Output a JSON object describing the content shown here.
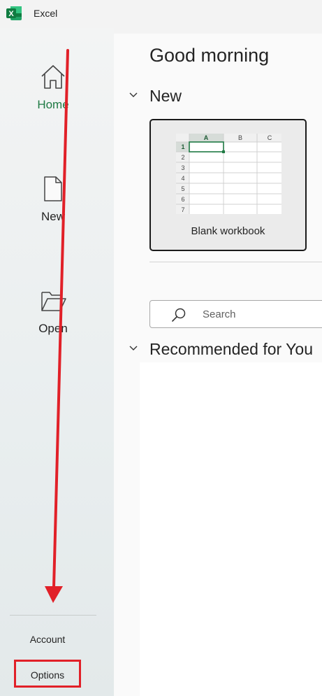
{
  "app": {
    "title": "Excel",
    "logo_letter": "X"
  },
  "sidebar": {
    "items": [
      {
        "label": "Home",
        "icon": "home-icon",
        "active": true
      },
      {
        "label": "New",
        "icon": "new-document-icon",
        "active": false
      },
      {
        "label": "Open",
        "icon": "folder-open-icon",
        "active": false
      }
    ],
    "account_label": "Account",
    "options_label": "Options"
  },
  "main": {
    "greeting": "Good morning",
    "new_section": {
      "title": "New",
      "templates": [
        {
          "label": "Blank workbook",
          "columns": [
            "A",
            "B",
            "C"
          ],
          "rows": [
            "1",
            "2",
            "3",
            "4",
            "5",
            "6",
            "7"
          ]
        }
      ]
    },
    "search": {
      "placeholder": "Search"
    },
    "recommended_title": "Recommended for You"
  },
  "colors": {
    "accent_green": "#1f7a44",
    "annotation_red": "#e12028",
    "excel_green": "#107c41"
  }
}
